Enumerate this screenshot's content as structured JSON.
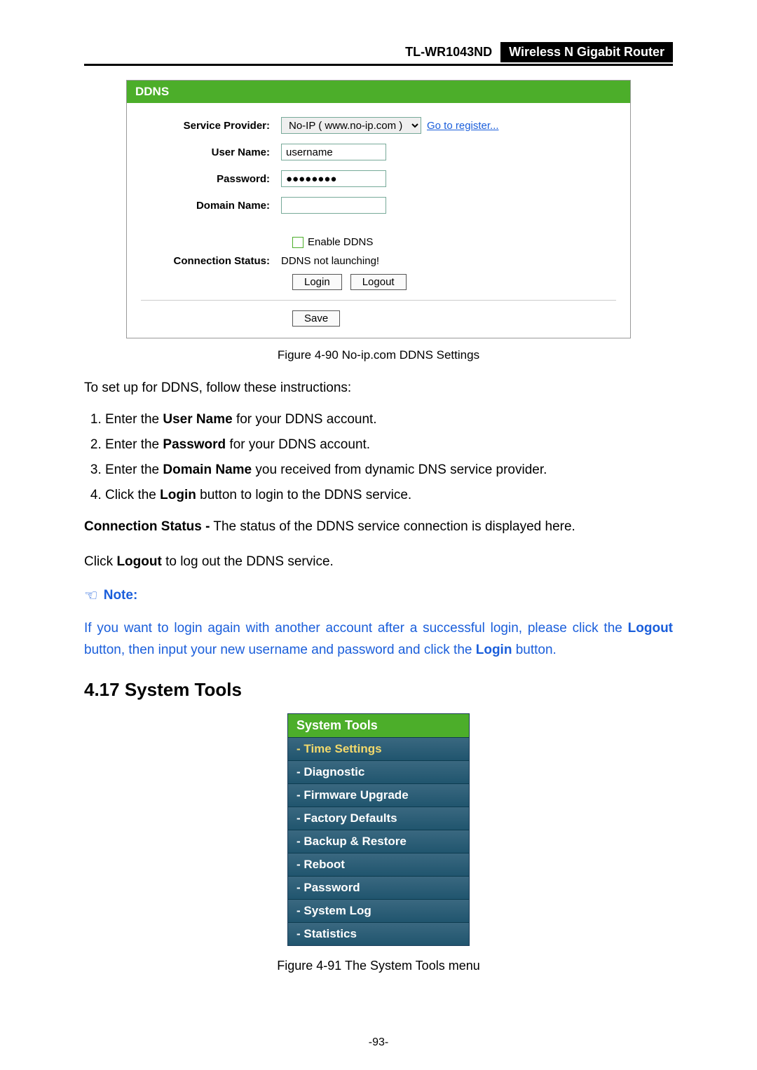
{
  "header": {
    "model": "TL-WR1043ND",
    "product": "Wireless N Gigabit Router"
  },
  "panel": {
    "title": "DDNS",
    "labels": {
      "service_provider": "Service Provider:",
      "user_name": "User Name:",
      "password": "Password:",
      "domain_name": "Domain Name:",
      "connection_status": "Connection Status:"
    },
    "values": {
      "provider_selected": "No-IP ( www.no-ip.com )",
      "register_link": "Go to register...",
      "username": "username",
      "password": "●●●●●●●●",
      "domain": "",
      "enable_label": "Enable DDNS",
      "status_text": "DDNS not launching!",
      "login_btn": "Login",
      "logout_btn": "Logout",
      "save_btn": "Save"
    }
  },
  "caption1": "Figure 4-90 No-ip.com DDNS Settings",
  "intro": "To set up for DDNS, follow these instructions:",
  "steps": {
    "s1a": "Enter the ",
    "s1b": "User Name",
    "s1c": " for your DDNS account.",
    "s2a": "Enter the ",
    "s2b": "Password",
    "s2c": " for your DDNS account.",
    "s3a": "Enter the ",
    "s3b": "Domain Name",
    "s3c": " you received from dynamic DNS service provider.",
    "s4a": "Click the ",
    "s4b": "Login",
    "s4c": " button to login to the DDNS service."
  },
  "conn": {
    "a": "Connection Status -",
    "b": " The status of the DDNS service connection is displayed here."
  },
  "logout_line": {
    "a": "Click ",
    "b": "Logout",
    "c": " to log out the DDNS service."
  },
  "note": {
    "label": "Note:",
    "t1": " If you want to login again with another account after a successful login, please click the ",
    "t2": "Logout",
    "t3": " button, then input your new username and password and click the ",
    "t4": "Login",
    "t5": " button."
  },
  "section_heading": "4.17  System Tools",
  "menu": {
    "head": "System Tools",
    "items": [
      "- Time Settings",
      "- Diagnostic",
      "- Firmware Upgrade",
      "- Factory Defaults",
      "- Backup & Restore",
      "- Reboot",
      "- Password",
      "- System Log",
      "- Statistics"
    ]
  },
  "caption2": "Figure 4-91    The System Tools menu",
  "page_number": "-93-"
}
